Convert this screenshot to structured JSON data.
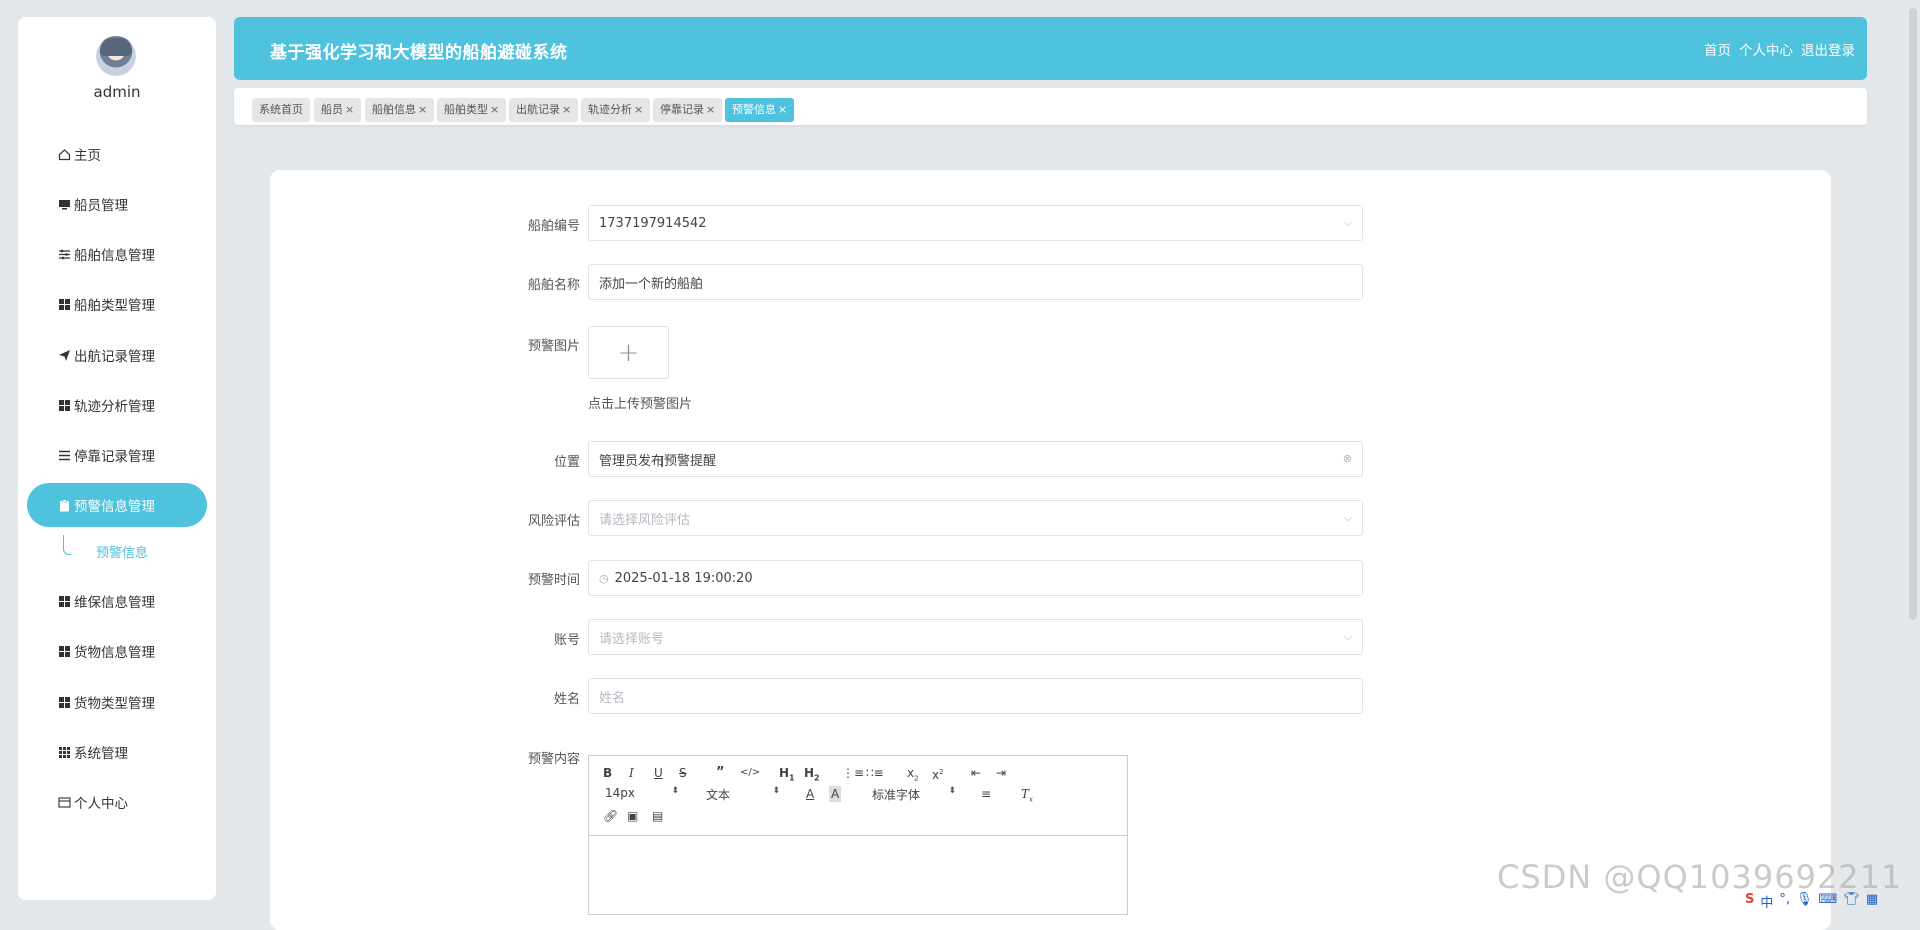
{
  "user": {
    "name": "admin"
  },
  "sidebar": {
    "items": [
      {
        "label": "主页",
        "icon": "home-icon"
      },
      {
        "label": "船员管理",
        "icon": "monitor-icon"
      },
      {
        "label": "船舶信息管理",
        "icon": "sliders-icon"
      },
      {
        "label": "船舶类型管理",
        "icon": "grid-icon"
      },
      {
        "label": "出航记录管理",
        "icon": "send-icon"
      },
      {
        "label": "轨迹分析管理",
        "icon": "grid-icon"
      },
      {
        "label": "停靠记录管理",
        "icon": "list-icon"
      },
      {
        "label": "预警信息管理",
        "icon": "clipboard-icon"
      },
      {
        "label": "维保信息管理",
        "icon": "grid-icon"
      },
      {
        "label": "货物信息管理",
        "icon": "grid-icon"
      },
      {
        "label": "货物类型管理",
        "icon": "grid-icon"
      },
      {
        "label": "系统管理",
        "icon": "apps-icon"
      },
      {
        "label": "个人中心",
        "icon": "card-icon"
      }
    ],
    "submenu": {
      "label": "预警信息"
    }
  },
  "header": {
    "title": "基于强化学习和大模型的船舶避碰系统",
    "nav": {
      "home": "首页",
      "profile": "个人中心",
      "logout": "退出登录"
    }
  },
  "tabs": [
    {
      "label": "系统首页",
      "closable": false
    },
    {
      "label": "船员",
      "closable": true
    },
    {
      "label": "船舶信息",
      "closable": true
    },
    {
      "label": "船舶类型",
      "closable": true
    },
    {
      "label": "出航记录",
      "closable": true
    },
    {
      "label": "轨迹分析",
      "closable": true
    },
    {
      "label": "停靠记录",
      "closable": true
    },
    {
      "label": "预警信息",
      "closable": true,
      "active": true
    }
  ],
  "tab_close_glyph": "×",
  "form": {
    "ship_no": {
      "label": "船舶编号",
      "value": "1737197914542"
    },
    "ship_name": {
      "label": "船舶名称",
      "value": "添加一个新的船舶"
    },
    "image": {
      "label": "预警图片",
      "plus": "+",
      "hint": "点击上传预警图片"
    },
    "location": {
      "label": "位置",
      "value": "管理员发布预警提醒"
    },
    "risk": {
      "label": "风险评估",
      "placeholder": "请选择风险评估"
    },
    "time": {
      "label": "预警时间",
      "value": "2025-01-18 19:00:20"
    },
    "account": {
      "label": "账号",
      "placeholder": "请选择账号"
    },
    "name": {
      "label": "姓名",
      "placeholder": "姓名"
    },
    "content": {
      "label": "预警内容"
    }
  },
  "editor": {
    "font_size": "14px",
    "block": "文本",
    "font_family": "标准字体"
  },
  "watermark": "CSDN @QQ1039692211",
  "tray": {
    "ime": "中"
  },
  "colors": {
    "accent": "#4fc2dd",
    "background": "#e5e8ea"
  }
}
